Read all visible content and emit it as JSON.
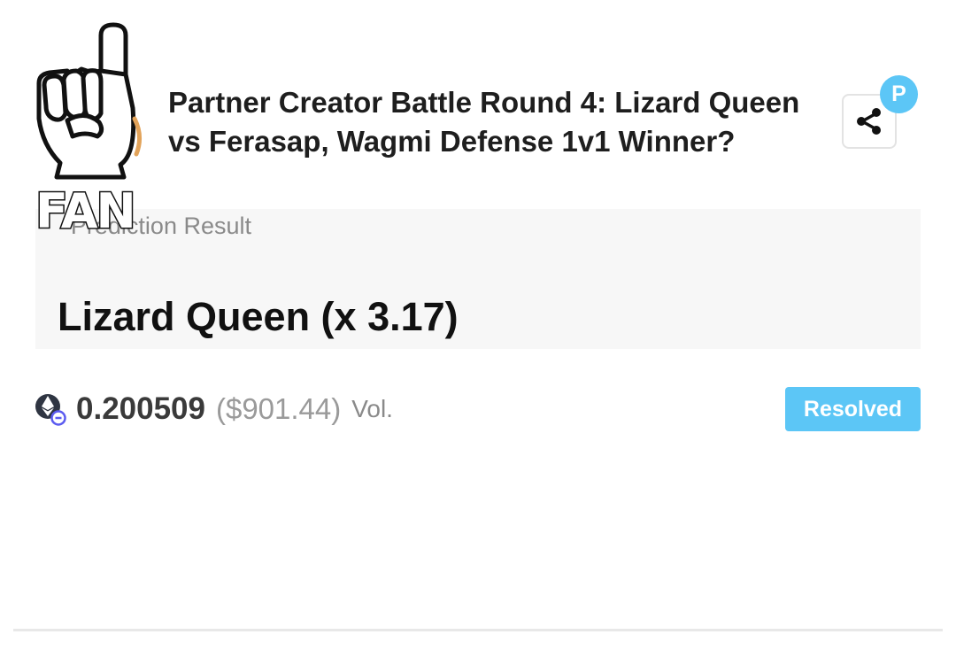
{
  "header": {
    "logo_text": "FAN",
    "title": "Partner Creator Battle Round 4: Lizard Queen vs Ferasap, Wagmi Defense 1v1 Winner?",
    "avatar_letter": "P"
  },
  "result": {
    "label": "Prediction Result",
    "value": "Lizard Queen (x 3.17)"
  },
  "volume": {
    "amount": "0.200509",
    "usd": "($901.44)",
    "label": "Vol.",
    "icon": "ethereum-icon"
  },
  "status": {
    "label": "Resolved"
  },
  "colors": {
    "accent": "#5cc6f6",
    "card_background": "#f7f7f7",
    "divider": "#e8e8e8"
  },
  "icons": {
    "logo": "pointing-finger-icon",
    "share": "share-icon",
    "currency": "ethereum-icon"
  }
}
